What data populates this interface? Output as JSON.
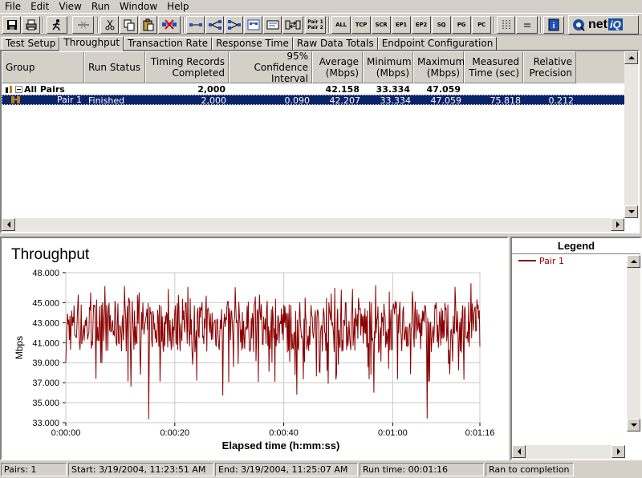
{
  "menubar": [
    "File",
    "Edit",
    "View",
    "Run",
    "Window",
    "Help"
  ],
  "toolbar": {
    "pair_label_1": "Pair 1",
    "pair_label_2": "Pair 2",
    "filters": [
      "ALL",
      "TCP",
      "SCR",
      "EP1",
      "EP2",
      "SQ",
      "PG",
      "PC"
    ],
    "logo_text": "net",
    "logo_accent": "iQ"
  },
  "tabs": [
    "Test Setup",
    "Throughput",
    "Transaction Rate",
    "Response Time",
    "Raw Data Totals",
    "Endpoint Configuration"
  ],
  "active_tab": "Throughput",
  "grid": {
    "columns": [
      {
        "line1": "",
        "line2": "Group"
      },
      {
        "line1": "",
        "line2": "Run Status"
      },
      {
        "line1": "Timing Records",
        "line2": "Completed"
      },
      {
        "line1": "95% Confidence",
        "line2": "Interval"
      },
      {
        "line1": "Average",
        "line2": "(Mbps)"
      },
      {
        "line1": "Minimum",
        "line2": "(Mbps)"
      },
      {
        "line1": "Maximum",
        "line2": "(Mbps)"
      },
      {
        "line1": "Measured",
        "line2": "Time (sec)"
      },
      {
        "line1": "Relative",
        "line2": "Precision"
      }
    ],
    "rows": [
      {
        "group": "All Pairs",
        "status": "",
        "records": "2,000",
        "confidence": "",
        "average": "42.158",
        "minimum": "33.334",
        "maximum": "47.059",
        "measured": "",
        "precision": ""
      },
      {
        "group": "Pair 1",
        "status": "Finished",
        "records": "2,000",
        "confidence": "0.090",
        "average": "42.207",
        "minimum": "33.334",
        "maximum": "47.059",
        "measured": "75.818",
        "precision": "0.212"
      }
    ]
  },
  "chart_data": {
    "type": "line",
    "title": "Throughput",
    "xlabel": "Elapsed time (h:mm:ss)",
    "ylabel": "Mbps",
    "ylim": [
      33.0,
      48.0
    ],
    "xlim_seconds": [
      0,
      76
    ],
    "yticks": [
      "33.000",
      "35.000",
      "37.000",
      "39.000",
      "41.000",
      "43.000",
      "45.000",
      "48.000"
    ],
    "xticks": [
      "0:00:00",
      "0:00:20",
      "0:00:40",
      "0:01:00",
      "0:01:16"
    ],
    "grid": true,
    "series": [
      {
        "name": "Pair 1",
        "color": "#8b0000",
        "summary": {
          "points": 2000,
          "average": 42.207,
          "minimum": 33.334,
          "maximum": 47.059
        }
      }
    ]
  },
  "legend": {
    "title": "Legend",
    "items": [
      {
        "label": "Pair 1",
        "color": "#8b0000"
      }
    ]
  },
  "status": {
    "pairs": "Pairs: 1",
    "start": "Start: 3/19/2004, 11:23:51 AM",
    "end": "End: 3/19/2004, 11:25:07 AM",
    "runtime": "Run time: 00:01:16",
    "result": "Ran to completion"
  }
}
